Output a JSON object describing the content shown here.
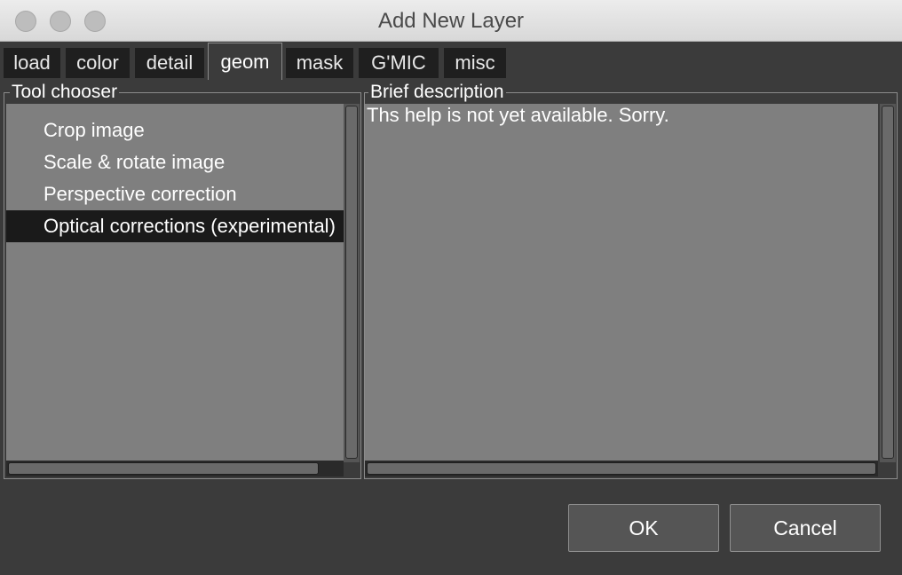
{
  "window": {
    "title": "Add New Layer"
  },
  "tabs": [
    {
      "label": "load"
    },
    {
      "label": "color"
    },
    {
      "label": "detail"
    },
    {
      "label": "geom",
      "active": true
    },
    {
      "label": "mask"
    },
    {
      "label": "G'MIC"
    },
    {
      "label": "misc"
    }
  ],
  "tool_chooser": {
    "title": "Tool chooser",
    "items": [
      {
        "label": "Crop image"
      },
      {
        "label": "Scale & rotate image"
      },
      {
        "label": "Perspective correction"
      },
      {
        "label": "Optical corrections (experimental)",
        "selected": true
      }
    ]
  },
  "brief_description": {
    "title": "Brief description",
    "text": "Ths help is not yet available. Sorry."
  },
  "buttons": {
    "ok": "OK",
    "cancel": "Cancel"
  },
  "colors": {
    "window_bg": "#3b3b3b",
    "panel_bg": "#7f7f7f",
    "selection_bg": "#1a1a1a",
    "tab_bg": "#1f1f1f",
    "button_bg": "#555555"
  }
}
